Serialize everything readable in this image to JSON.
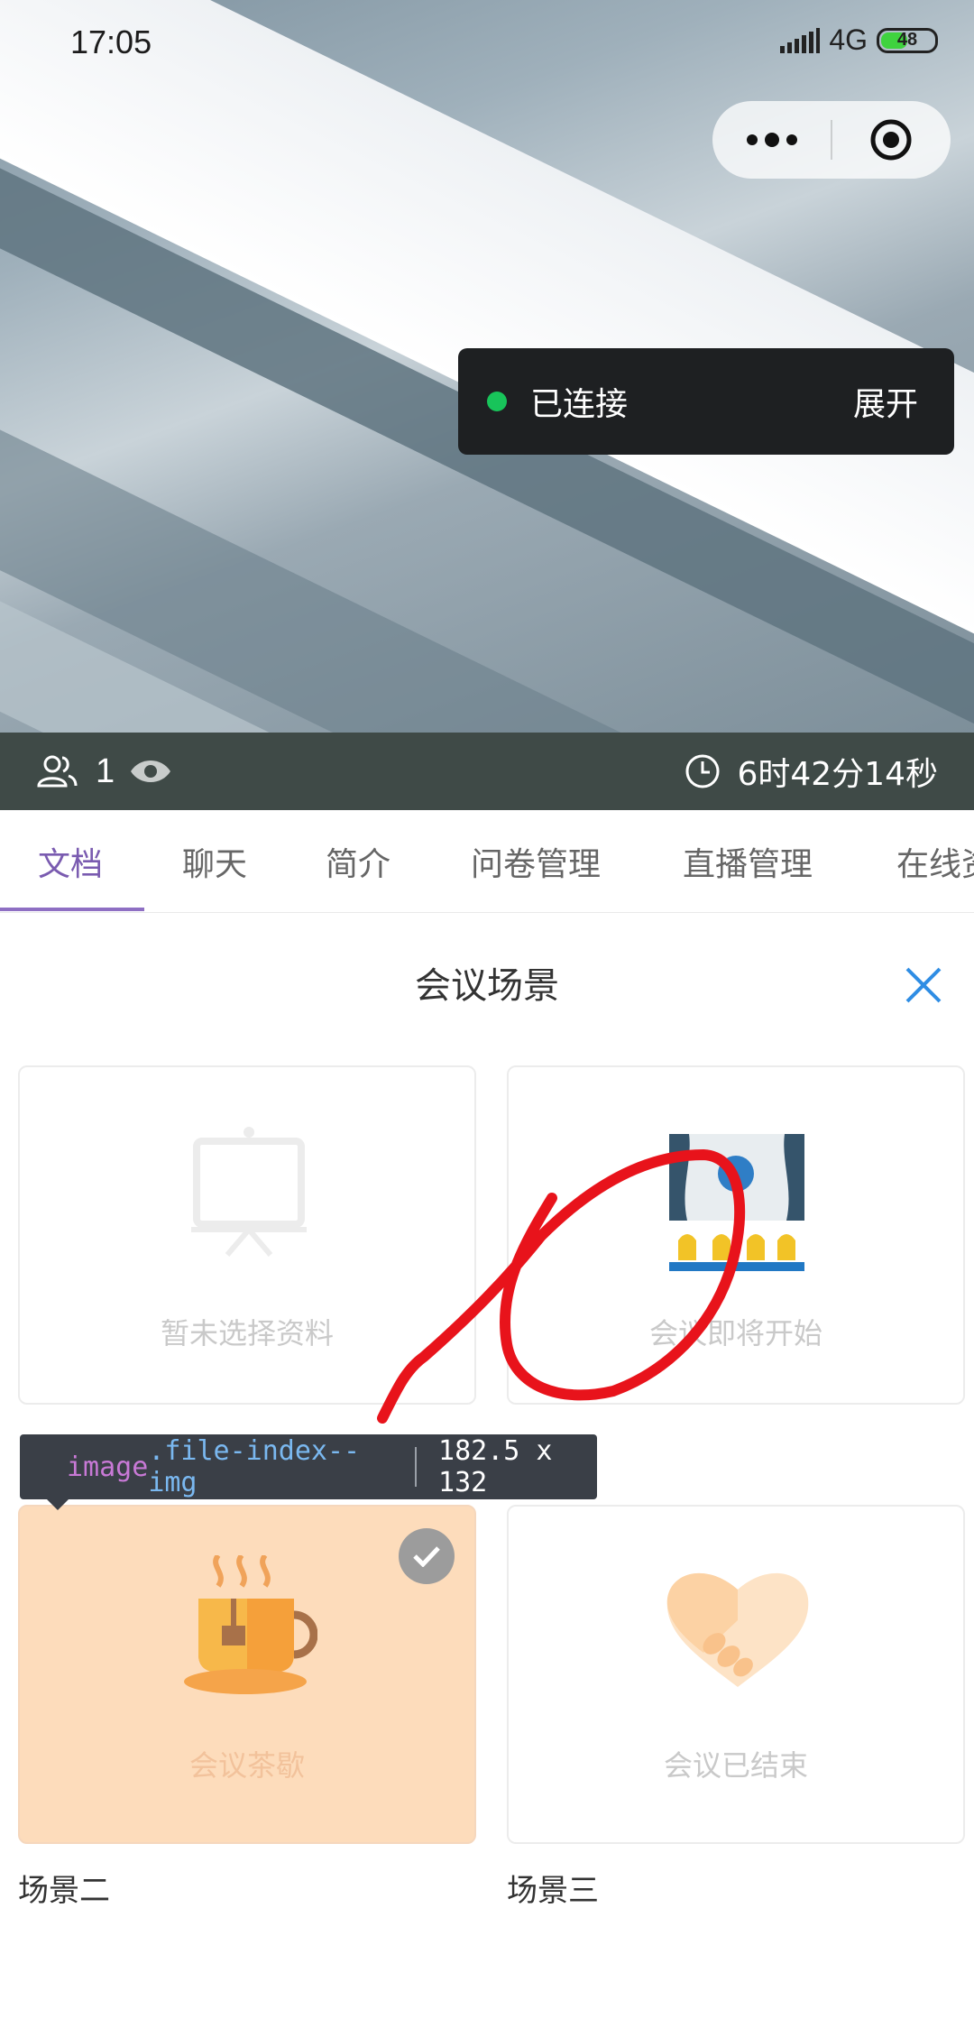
{
  "status_bar": {
    "time": "17:05",
    "network": "4G",
    "battery": "48"
  },
  "connection": {
    "status": "已连接",
    "expand_label": "展开",
    "dot_color": "#18c45a"
  },
  "info": {
    "viewers": "1",
    "duration": "6时42分14秒"
  },
  "tabs": [
    {
      "label": "文档",
      "active": true
    },
    {
      "label": "聊天"
    },
    {
      "label": "简介"
    },
    {
      "label": "问卷管理"
    },
    {
      "label": "直播管理"
    },
    {
      "label": "在线资"
    }
  ],
  "panel": {
    "title": "会议场景"
  },
  "scenes": [
    {
      "caption": "暂未选择资料",
      "label": ""
    },
    {
      "caption": "会议即将开始",
      "label": ""
    },
    {
      "caption": "会议茶歇",
      "label": "场景二",
      "selected": true
    },
    {
      "caption": "会议已结束",
      "label": "场景三"
    }
  ],
  "inspector": {
    "tag": "image",
    "cls": ".file-index--img",
    "size": "182.5 x 132"
  },
  "colors": {
    "accent": "#7a5bb0",
    "selected_card": "#fddcbb",
    "annotation": "#e8131b"
  }
}
